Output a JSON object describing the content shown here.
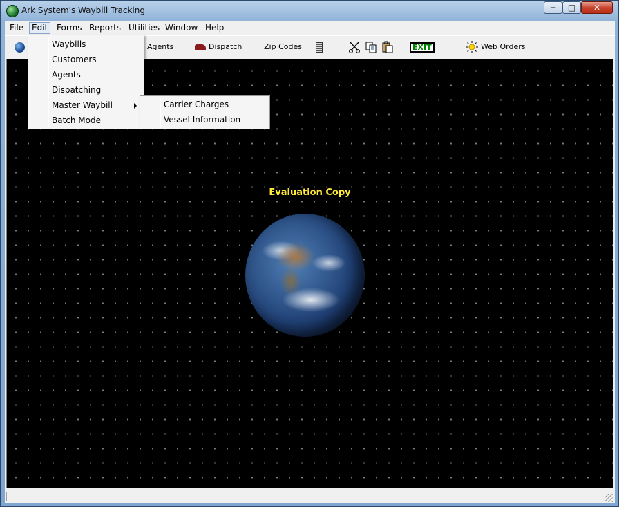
{
  "window": {
    "title": "Ark System's Waybill Tracking",
    "controls": {
      "minimize": "─",
      "maximize": "□",
      "close": "✕"
    }
  },
  "menubar": {
    "items": [
      {
        "label": "File"
      },
      {
        "label": "Edit",
        "active": true
      },
      {
        "label": "Forms"
      },
      {
        "label": "Reports"
      },
      {
        "label": "Utilities"
      },
      {
        "label": "Window"
      },
      {
        "label": "Help"
      }
    ]
  },
  "toolbar": {
    "agents": "Agents",
    "dispatch": "Dispatch",
    "zip_codes": "Zip Codes",
    "exit": "EXIT",
    "web_orders": "Web Orders"
  },
  "edit_menu": {
    "items": [
      {
        "label": "Waybills"
      },
      {
        "label": "Customers"
      },
      {
        "label": "Agents"
      },
      {
        "label": "Dispatching"
      },
      {
        "label": "Master Waybill",
        "submenu": true
      },
      {
        "label": "Batch Mode"
      }
    ]
  },
  "master_waybill_submenu": {
    "items": [
      {
        "label": "Carrier Charges"
      },
      {
        "label": "Vessel Information"
      }
    ]
  },
  "main": {
    "watermark": "Evaluation Copy"
  },
  "colors": {
    "watermark": "#ffea3a",
    "exit_text": "#008000"
  }
}
